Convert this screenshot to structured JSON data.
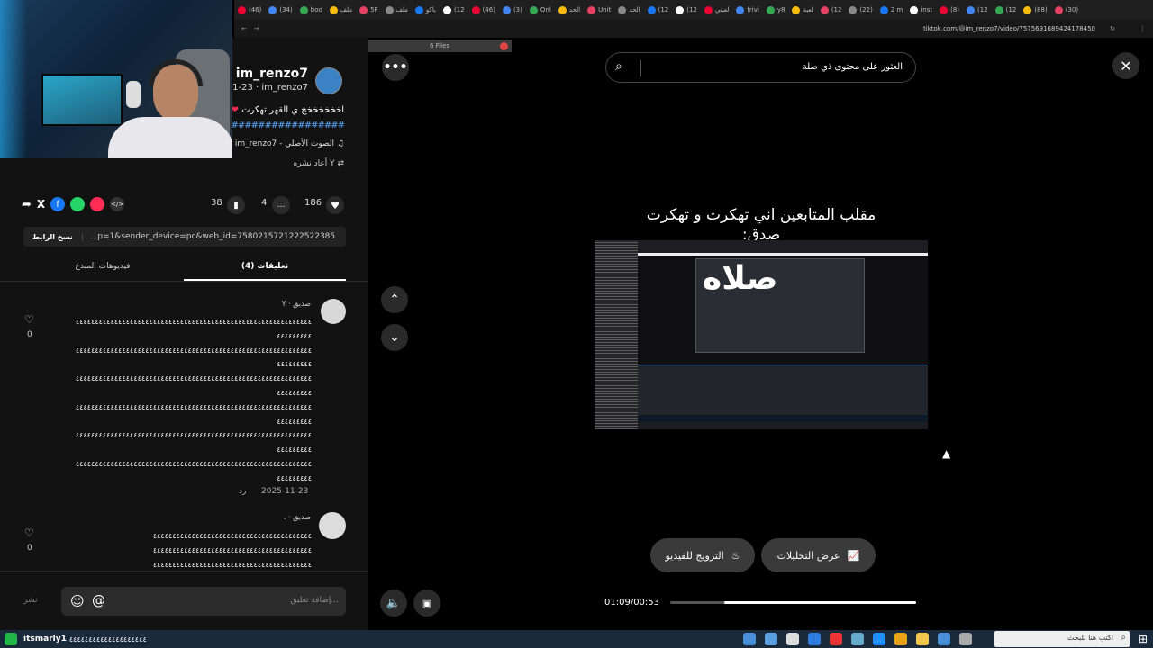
{
  "browser": {
    "tabs": [
      "(46)",
      "(34)",
      "boo",
      "ملف",
      "5F",
      "ملف",
      "باكو",
      "(12",
      "(46)",
      "(3)",
      "Onl",
      "الحد",
      "Unit",
      "الحد",
      "(12",
      "(12",
      "لعبتي",
      "frivi",
      "y8",
      "لعبة",
      "(12",
      "(22)",
      "2 m",
      "inst",
      "(8)",
      "(12",
      "(12",
      "(88)",
      "(30)"
    ],
    "url": "tiktok.com/@im_renzo7/video/7575691689424178450",
    "files_label": "6 Files"
  },
  "post": {
    "username": "im_renzo7",
    "meta": "11-23 · im_renzo7",
    "caption": "اخخخخخخخ ي القهر تهكرت",
    "hashtags": "#########################",
    "sound": "الصوت الأصلي - im_renzo7",
    "reposted": "Y أعاد نشره",
    "likes": "186",
    "comments": "4",
    "saves": "38",
    "link": "...p=1&sender_device=pc&web_id=7580215721222522385",
    "copy_link": "نسخ الرابط"
  },
  "tabs": {
    "comments": "تعليقات (4)",
    "creator_videos": "فيديوهات المبدع"
  },
  "comments": [
    {
      "author": "Y · صديق",
      "lines": [
        "٤٤٤٤٤٤٤٤٤٤٤٤٤٤٤٤٤٤٤٤٤٤٤٤٤٤٤٤٤٤٤٤٤٤٤٤٤٤٤٤٤٤٤٤٤٤٤٤٤٤٤٤٤٤٤٤٤٤٤٤٤",
        "٤٤٤٤٤٤٤٤٤",
        "٤٤٤٤٤٤٤٤٤٤٤٤٤٤٤٤٤٤٤٤٤٤٤٤٤٤٤٤٤٤٤٤٤٤٤٤٤٤٤٤٤٤٤٤٤٤٤٤٤٤٤٤٤٤٤٤٤٤٤٤٤",
        "٤٤٤٤٤٤٤٤٤",
        "٤٤٤٤٤٤٤٤٤٤٤٤٤٤٤٤٤٤٤٤٤٤٤٤٤٤٤٤٤٤٤٤٤٤٤٤٤٤٤٤٤٤٤٤٤٤٤٤٤٤٤٤٤٤٤٤٤٤٤٤٤",
        "٤٤٤٤٤٤٤٤٤",
        "٤٤٤٤٤٤٤٤٤٤٤٤٤٤٤٤٤٤٤٤٤٤٤٤٤٤٤٤٤٤٤٤٤٤٤٤٤٤٤٤٤٤٤٤٤٤٤٤٤٤٤٤٤٤٤٤٤٤٤٤٤",
        "٤٤٤٤٤٤٤٤٤",
        "٤٤٤٤٤٤٤٤٤٤٤٤٤٤٤٤٤٤٤٤٤٤٤٤٤٤٤٤٤٤٤٤٤٤٤٤٤٤٤٤٤٤٤٤٤٤٤٤٤٤٤٤٤٤٤٤٤٤٤٤٤",
        "٤٤٤٤٤٤٤٤٤",
        "٤٤٤٤٤٤٤٤٤٤٤٤٤٤٤٤٤٤٤٤٤٤٤٤٤٤٤٤٤٤٤٤٤٤٤٤٤٤٤٤٤٤٤٤٤٤٤٤٤٤٤٤٤٤٤٤٤٤٤٤٤",
        "٤٤٤٤٤٤٤٤٤"
      ],
      "date": "2025-11-23",
      "reply": "رد",
      "likes": "0"
    },
    {
      "author": ". · صديق",
      "lines": [
        "٤٤٤٤٤٤٤٤٤٤٤٤٤٤٤٤٤٤٤٤٤٤٤٤٤٤٤٤٤٤٤٤٤٤٤٤٤٤٤٤٤",
        "٤٤٤٤٤٤٤٤٤٤٤٤٤٤٤٤٤٤٤٤٤٤٤٤٤٤٤٤٤٤٤٤٤٤٤٤٤٤٤٤٤",
        "٤٤٤٤٤٤٤٤٤٤٤٤٤٤٤٤٤٤٤٤٤٤٤٤٤٤٤٤٤٤٤٤٤٤٤٤٤٤٤٤٤"
      ],
      "likes": "0"
    }
  ],
  "comment_input": {
    "placeholder": "إضافة تعليق...",
    "post": "نشر"
  },
  "player": {
    "search_placeholder": "العثور على محتوى ذي صلة",
    "video_caption": "مقلب المتابعين اني تهكرت و تهكرت صدق:",
    "overlay_word": "صلاه",
    "analytics": "عرض التحليلات",
    "promote": "الترويج للفيديو",
    "time": "01:09/00:53",
    "progress": 0.78
  },
  "taskbar": {
    "search_placeholder": "اكتب هنا للبحث",
    "stream_user": "itsmarly1",
    "stream_text": "٤٤٤٤٤٤٤٤٤٤٤٤٤٤٤٤٤٤٤٤"
  },
  "colors": {
    "accent": "#fe2c55",
    "panel_bg": "#121212",
    "tab_active": "#ffffff"
  }
}
